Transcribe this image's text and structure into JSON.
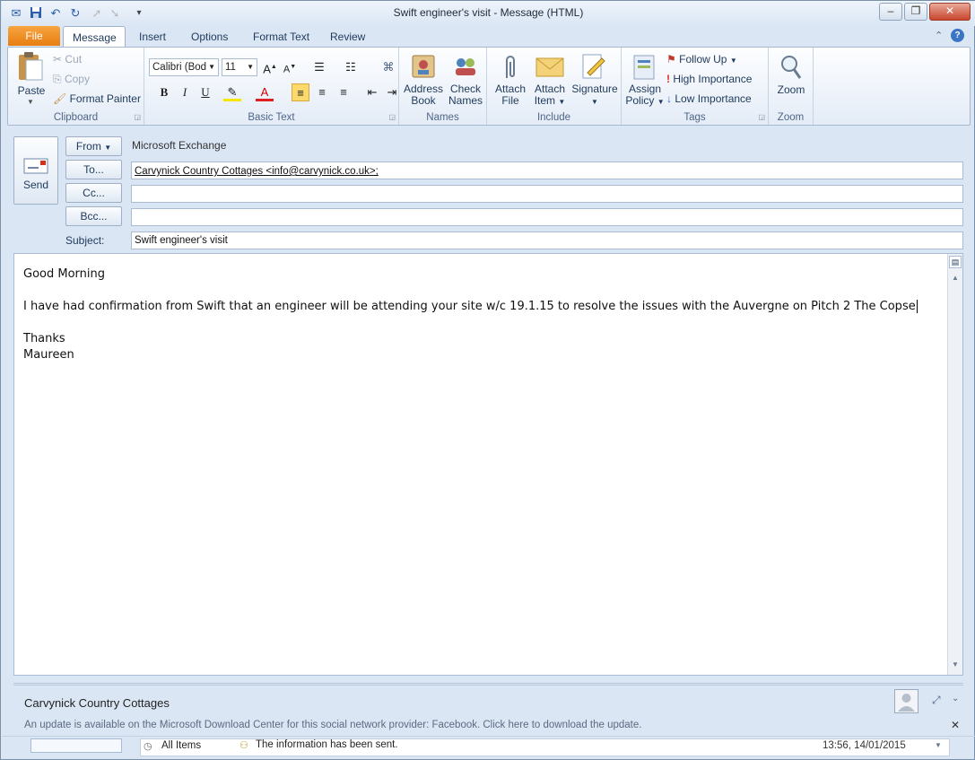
{
  "window": {
    "title": "Swift engineer's visit  -  Message (HTML)",
    "controls": [
      "minimize-icon",
      "restore-icon",
      "close-icon"
    ]
  },
  "quick_access": {
    "icons": [
      "outlook-icon",
      "save-icon",
      "undo-icon",
      "redo-icon",
      "up-arrow-icon",
      "down-arrow-icon",
      "customize-icon"
    ]
  },
  "tabs": {
    "file": "File",
    "items": [
      "Message",
      "Insert",
      "Options",
      "Format Text",
      "Review"
    ],
    "active": "Message"
  },
  "ribbon": {
    "clipboard": {
      "label": "Clipboard",
      "paste": "Paste",
      "cut": "Cut",
      "copy": "Copy",
      "format_painter": "Format Painter"
    },
    "basic_text": {
      "label": "Basic Text",
      "font": "Calibri (Bod",
      "size": "11",
      "bold": "B",
      "italic": "I",
      "underline": "U"
    },
    "names": {
      "label": "Names",
      "address_book_1": "Address",
      "address_book_2": "Book",
      "check_names_1": "Check",
      "check_names_2": "Names"
    },
    "include": {
      "label": "Include",
      "attach_file_1": "Attach",
      "attach_file_2": "File",
      "attach_item_1": "Attach",
      "attach_item_2": "Item",
      "signature": "Signature"
    },
    "tags": {
      "label": "Tags",
      "assign_1": "Assign",
      "assign_2": "Policy",
      "follow_up": "Follow Up",
      "high": "High Importance",
      "low": "Low Importance"
    },
    "zoom": {
      "label": "Zoom",
      "zoom": "Zoom"
    }
  },
  "header": {
    "send": "Send",
    "from_btn": "From",
    "from_value": "Microsoft Exchange",
    "to_btn": "To...",
    "to_value": "Carvynick Country Cottages <info@carvynick.co.uk>;",
    "cc_btn": "Cc...",
    "cc_value": "",
    "bcc_btn": "Bcc...",
    "bcc_value": "",
    "subject_label": "Subject:",
    "subject_value": "Swift engineer's visit"
  },
  "body": {
    "line1": "Good Morning",
    "line2": "I have had confirmation from Swift that an engineer will be attending your site w/c 19.1.15 to resolve the issues with the Auvergne on Pitch 2 The Copse",
    "line3": "Thanks",
    "line4": "Maureen"
  },
  "people_pane": {
    "name": "Carvynick Country Cottages",
    "update_notice": "An update is available on the Microsoft Download Center for this social network provider: Facebook. Click here to download the update."
  },
  "status_bar": {
    "filter": "All Items",
    "message": "The information has been sent.",
    "timestamp": "13:56, 14/01/2015"
  },
  "colors": {
    "file_tab": "#e87d10",
    "ribbon_bg": "#e4ecf7",
    "frame": "#dbe6f4",
    "text": "#1e395b"
  }
}
